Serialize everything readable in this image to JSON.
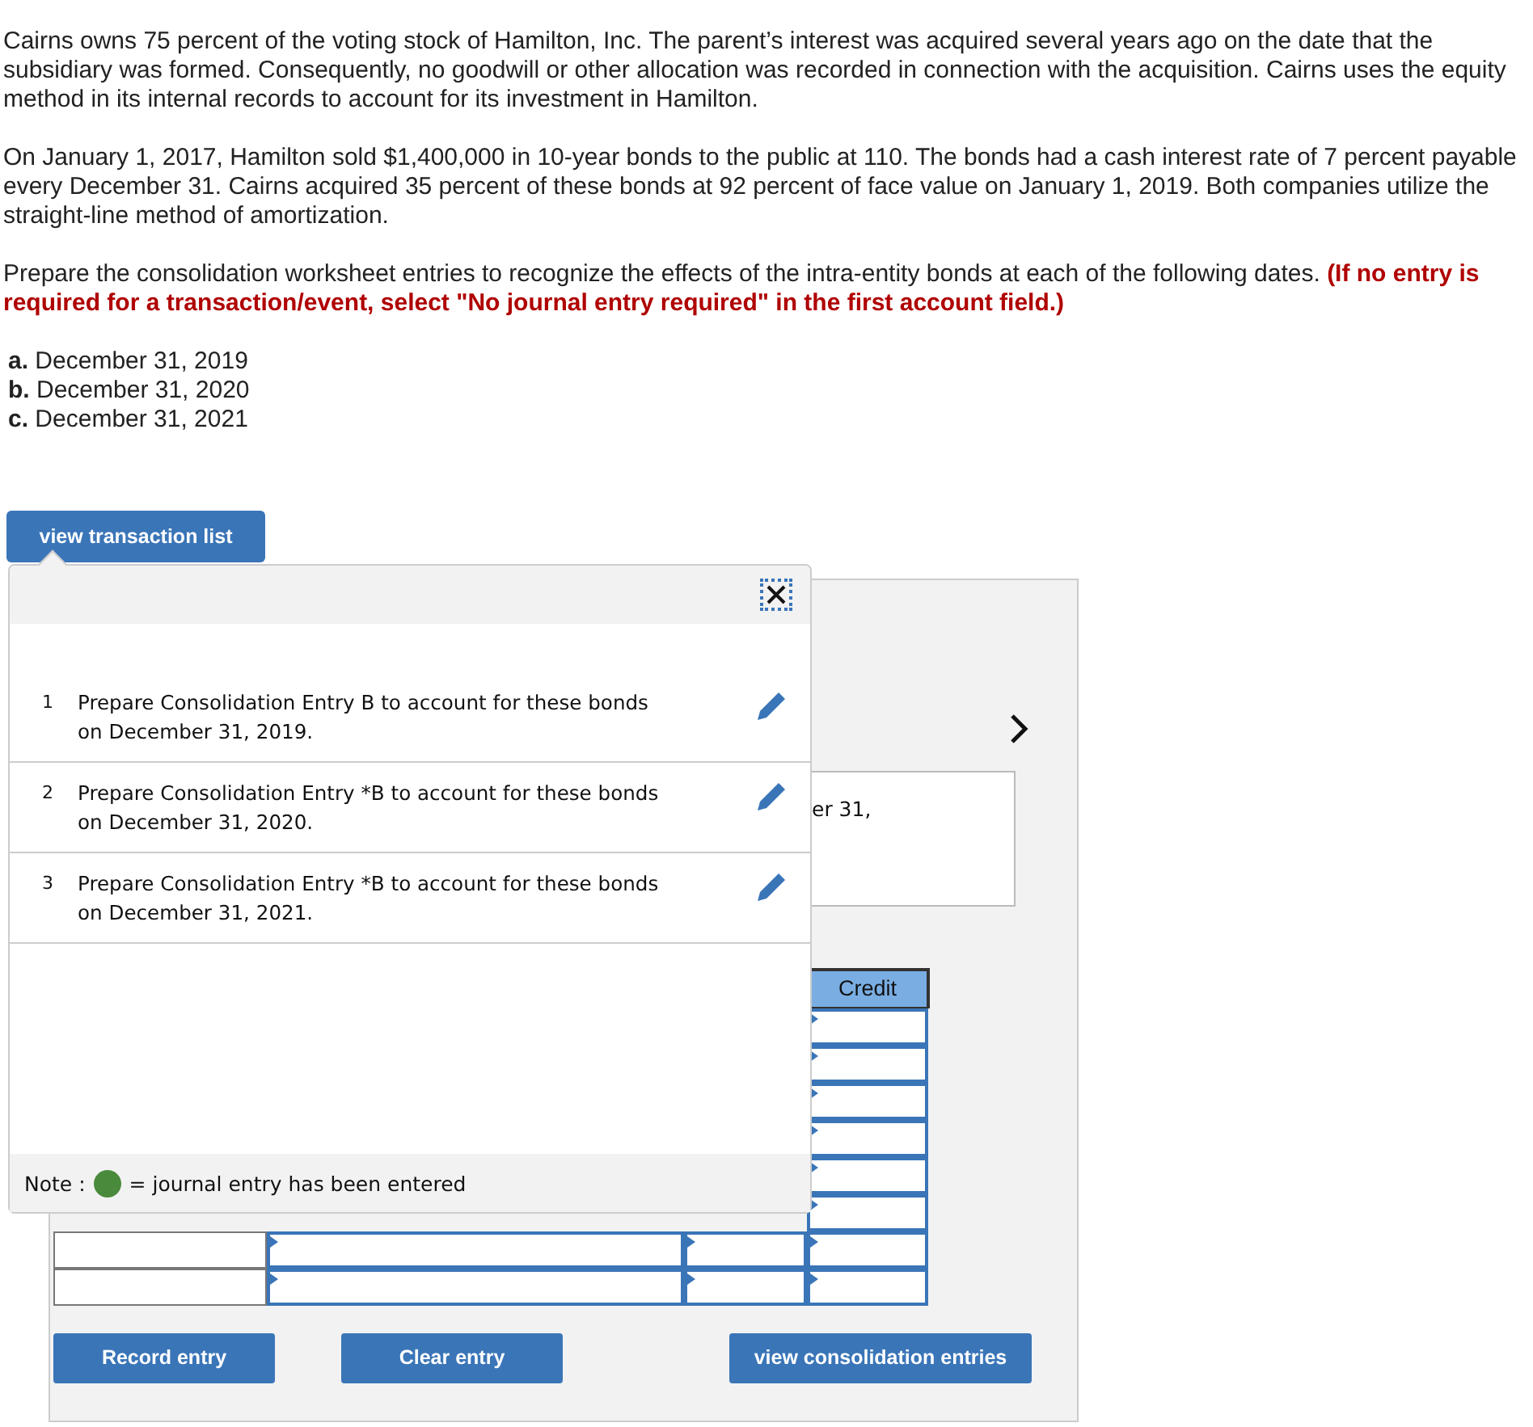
{
  "question": {
    "paragraphs": [
      "Cairns owns 75 percent of the voting stock of Hamilton, Inc. The parent’s interest was acquired several years ago on the date that the subsidiary was formed. Consequently, no goodwill or other allocation was recorded in connection with the acquisition. Cairns uses the equity method in its internal records to account for its investment in Hamilton.",
      "On January 1, 2017, Hamilton sold $1,400,000 in 10-year bonds to the public at 110. The bonds had a cash interest rate of 7 percent payable every December 31. Cairns acquired 35 percent of these bonds at 92 percent of face value on January 1, 2019. Both companies utilize the straight-line method of amortization.",
      "Prepare the consolidation worksheet entries to recognize the effects of the intra-entity bonds at each of the following dates. **(If no entry is required for a transaction/event, select \"No journal entry required\" in the first account field.)**"
    ],
    "parts": [
      "**a.** December 31, 2019",
      "**b.** December 31, 2020",
      "**c.** December 31, 2021"
    ]
  },
  "view_transaction_list_button": "view transaction list",
  "transaction_list": {
    "items": [
      {
        "number": "1",
        "text": "Prepare Consolidation Entry B to account for these bonds on December 31, 2019."
      },
      {
        "number": "2",
        "text": "Prepare Consolidation Entry *B to account for these bonds on December 31, 2020."
      },
      {
        "number": "3",
        "text": "Prepare Consolidation Entry *B to account for these bonds on December 31, 2021."
      }
    ],
    "note": {
      "label": "Note :",
      "color": "#4a8a3c",
      "text": "= journal entry has been entered"
    }
  },
  "entry_panel": {
    "description": "er 31,",
    "credit_header": "Credit",
    "buttons": [
      "Record entry",
      "Clear entry",
      "view consolidation entries"
    ]
  }
}
